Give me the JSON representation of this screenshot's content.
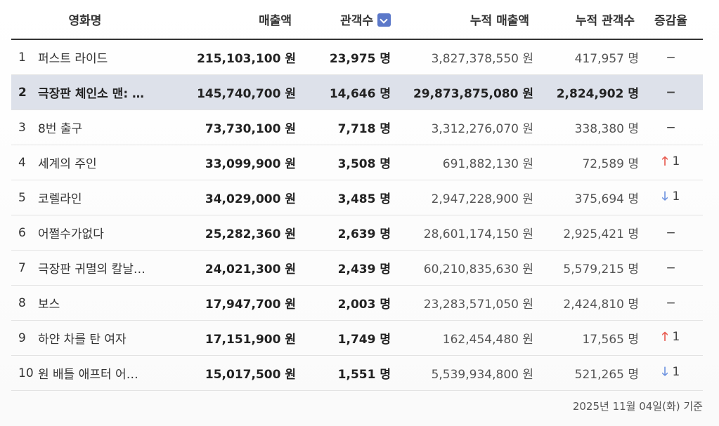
{
  "headers": {
    "title": "영화명",
    "sales": "매출액",
    "audience": "관객수",
    "cum_sales": "누적 매출액",
    "cum_audience": "누적 관객수",
    "change": "증감율"
  },
  "rows": [
    {
      "rank": "1",
      "title": "퍼스트 라이드",
      "sales": "215,103,100 원",
      "audience": "23,975 명",
      "cum_sales": "3,827,378,550 원",
      "cum_audience": "417,957 명",
      "change_type": "none",
      "change_text": "−",
      "change_num": ""
    },
    {
      "rank": "2",
      "title": "극장판 체인소 맨: …",
      "sales": "145,740,700 원",
      "audience": "14,646 명",
      "cum_sales": "29,873,875,080 원",
      "cum_audience": "2,824,902 명",
      "change_type": "none",
      "change_text": "−",
      "change_num": ""
    },
    {
      "rank": "3",
      "title": "8번 출구",
      "sales": "73,730,100 원",
      "audience": "7,718 명",
      "cum_sales": "3,312,276,070 원",
      "cum_audience": "338,380 명",
      "change_type": "none",
      "change_text": "−",
      "change_num": ""
    },
    {
      "rank": "4",
      "title": "세계의 주인",
      "sales": "33,099,900 원",
      "audience": "3,508 명",
      "cum_sales": "691,882,130 원",
      "cum_audience": "72,589 명",
      "change_type": "up",
      "change_text": "🡑",
      "change_num": "1"
    },
    {
      "rank": "5",
      "title": "코렐라인",
      "sales": "34,029,000 원",
      "audience": "3,485 명",
      "cum_sales": "2,947,228,900 원",
      "cum_audience": "375,694 명",
      "change_type": "down",
      "change_text": "🡓",
      "change_num": "1"
    },
    {
      "rank": "6",
      "title": "어쩔수가없다",
      "sales": "25,282,360 원",
      "audience": "2,639 명",
      "cum_sales": "28,601,174,150 원",
      "cum_audience": "2,925,421 명",
      "change_type": "none",
      "change_text": "−",
      "change_num": ""
    },
    {
      "rank": "7",
      "title": "극장판 귀멸의 칼날…",
      "sales": "24,021,300 원",
      "audience": "2,439 명",
      "cum_sales": "60,210,835,630 원",
      "cum_audience": "5,579,215 명",
      "change_type": "none",
      "change_text": "−",
      "change_num": ""
    },
    {
      "rank": "8",
      "title": "보스",
      "sales": "17,947,700 원",
      "audience": "2,003 명",
      "cum_sales": "23,283,571,050 원",
      "cum_audience": "2,424,810 명",
      "change_type": "none",
      "change_text": "−",
      "change_num": ""
    },
    {
      "rank": "9",
      "title": "하얀 차를 탄 여자",
      "sales": "17,151,900 원",
      "audience": "1,749 명",
      "cum_sales": "162,454,480 원",
      "cum_audience": "17,565 명",
      "change_type": "up",
      "change_text": "🡑",
      "change_num": "1"
    },
    {
      "rank": "10",
      "title": "원 배틀 애프터 어…",
      "sales": "15,017,500 원",
      "audience": "1,551 명",
      "cum_sales": "5,539,934,800 원",
      "cum_audience": "521,265 명",
      "change_type": "down",
      "change_text": "🡓",
      "change_num": "1"
    }
  ],
  "highlight_row": 1,
  "footer": "2025년 11월 04일(화) 기준",
  "colors": {
    "highlight_bg": "#dde1ea",
    "sort_icon": "#5b78c9",
    "up": "#e85a4f",
    "down": "#6f94e0"
  },
  "icons": {
    "sort": "chevron-down-icon",
    "up": "arrow-up-icon",
    "down": "arrow-down-icon"
  }
}
